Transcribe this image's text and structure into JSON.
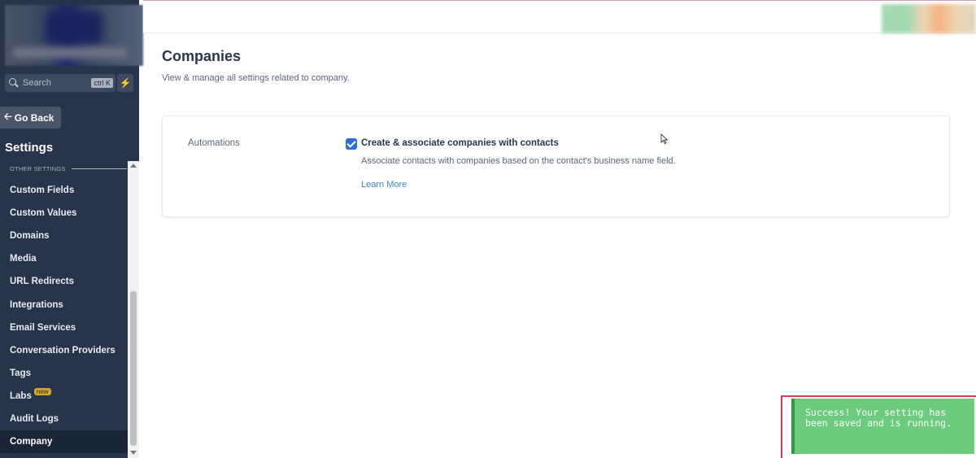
{
  "sidebar": {
    "search_placeholder": "Search",
    "search_shortcut": "ctrl K",
    "go_back_label": "Go Back",
    "settings_title": "Settings",
    "section_label": "OTHER SETTINGS",
    "items": [
      {
        "label": "Custom Fields"
      },
      {
        "label": "Custom Values"
      },
      {
        "label": "Domains"
      },
      {
        "label": "Media"
      },
      {
        "label": "URL Redirects"
      },
      {
        "label": "Integrations"
      },
      {
        "label": "Email Services"
      },
      {
        "label": "Conversation Providers"
      },
      {
        "label": "Tags"
      },
      {
        "label": "Labs",
        "badge": "new"
      },
      {
        "label": "Audit Logs"
      },
      {
        "label": "Company",
        "active": true
      }
    ]
  },
  "main": {
    "title": "Companies",
    "subtitle": "View & manage all settings related to company.",
    "card": {
      "label": "Automations",
      "option_title": "Create & associate companies with contacts",
      "option_checked": true,
      "option_description": "Associate contacts with companies based on the contact's business name field.",
      "learn_more": "Learn More"
    }
  },
  "toast": {
    "message": "Success! Your setting has been saved and is running."
  },
  "colors": {
    "sidebar_bg": "#27344a",
    "accent_blue": "#2c6fd6",
    "toast_green": "#6ccb7d",
    "badge_yellow": "#d6a72a"
  }
}
